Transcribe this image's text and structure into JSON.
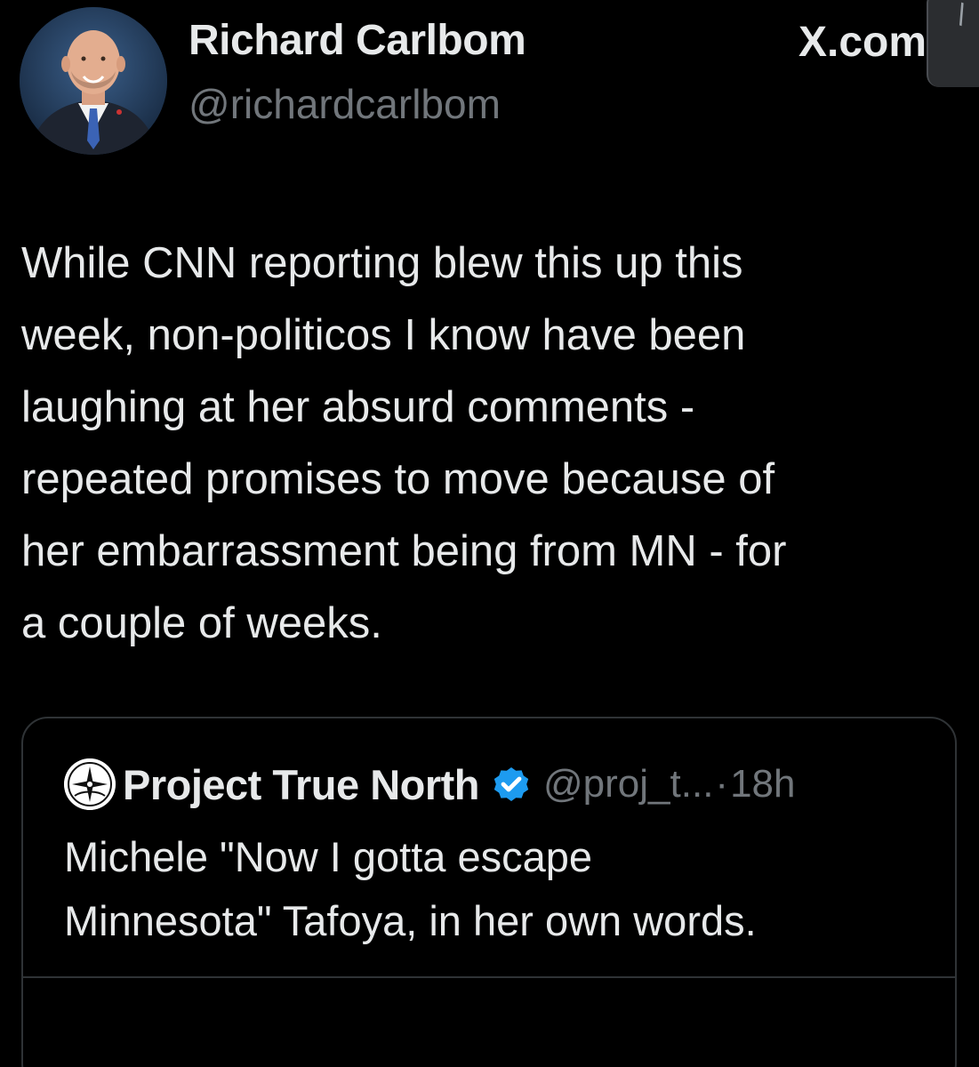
{
  "author": {
    "display_name": "Richard Carlbom",
    "handle": "@richardcarlbom"
  },
  "brand": {
    "site": "X.com"
  },
  "tweet": {
    "lines": [
      "While CNN reporting blew this up this",
      "week, non-politicos I know have been",
      "laughing at her absurd comments -",
      "repeated promises to move because of",
      "her embarrassment being from MN - for",
      "a couple of weeks."
    ]
  },
  "quoted_tweet": {
    "display_name": "Project True North",
    "handle": "@proj_t...",
    "separator": "·",
    "time": "18h",
    "lines": [
      "Michele \"Now I gotta escape",
      "Minnesota\" Tafoya, in her own words."
    ],
    "verified_color": "#1d9bf0"
  },
  "icons": {
    "avatar": "person-portrait",
    "quote_avatar": "compass-logo-icon",
    "verified": "verified-badge-icon",
    "corner": "chevron-icon"
  }
}
